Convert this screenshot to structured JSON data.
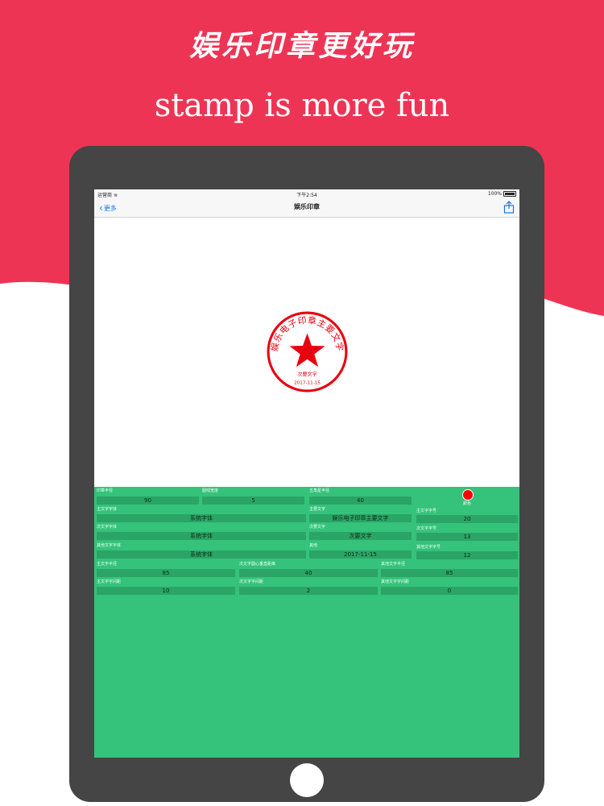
{
  "promo": {
    "headline_cn": "娱乐印章更好玩",
    "headline_en": "stamp is more fun",
    "bg_color": "#ee3454"
  },
  "status_bar": {
    "carrier": "运营商",
    "time": "下午2:54",
    "battery": "100%"
  },
  "nav": {
    "back_label": "更多",
    "title": "娱乐印章",
    "share_icon": "share-icon"
  },
  "stamp": {
    "main_text": "娱乐电子印章主要文字",
    "secondary_text": "次要文字",
    "other_text": "2017-11-15",
    "color": "#e8000f"
  },
  "settings": {
    "stamp_radius": {
      "label": "印章半径",
      "value": "90"
    },
    "ring_width": {
      "label": "圆线宽度",
      "value": "5"
    },
    "star_radius": {
      "label": "五角星半径",
      "value": "40"
    },
    "color": {
      "label": "颜色",
      "value": "#ff0000"
    },
    "main_font": {
      "label": "主文字字体",
      "value": "系统字体"
    },
    "main_text": {
      "label": "主要文字",
      "value": "娱乐电子印章主要文字"
    },
    "main_size": {
      "label": "主文字字号",
      "value": "20"
    },
    "sub_font": {
      "label": "次文字字体",
      "value": "系统字体"
    },
    "sub_text": {
      "label": "次要文字",
      "value": "次要文字"
    },
    "sub_size": {
      "label": "次文字字号",
      "value": "13"
    },
    "other_font": {
      "label": "其他文字字体",
      "value": "系统字体"
    },
    "other_text": {
      "label": "其他",
      "value": "2017-11-15"
    },
    "other_size": {
      "label": "其他文字字号",
      "value": "12"
    },
    "main_radius": {
      "label": "主文字半径",
      "value": "85"
    },
    "sub_center_dist": {
      "label": "次文字圆心垂直距离",
      "value": "40"
    },
    "other_radius": {
      "label": "其他文字半径",
      "value": "85"
    },
    "main_spacing": {
      "label": "主文字字间距",
      "value": "10"
    },
    "sub_spacing": {
      "label": "次文字字间距",
      "value": "2"
    },
    "other_spacing": {
      "label": "其他文字字间距",
      "value": "0"
    }
  }
}
